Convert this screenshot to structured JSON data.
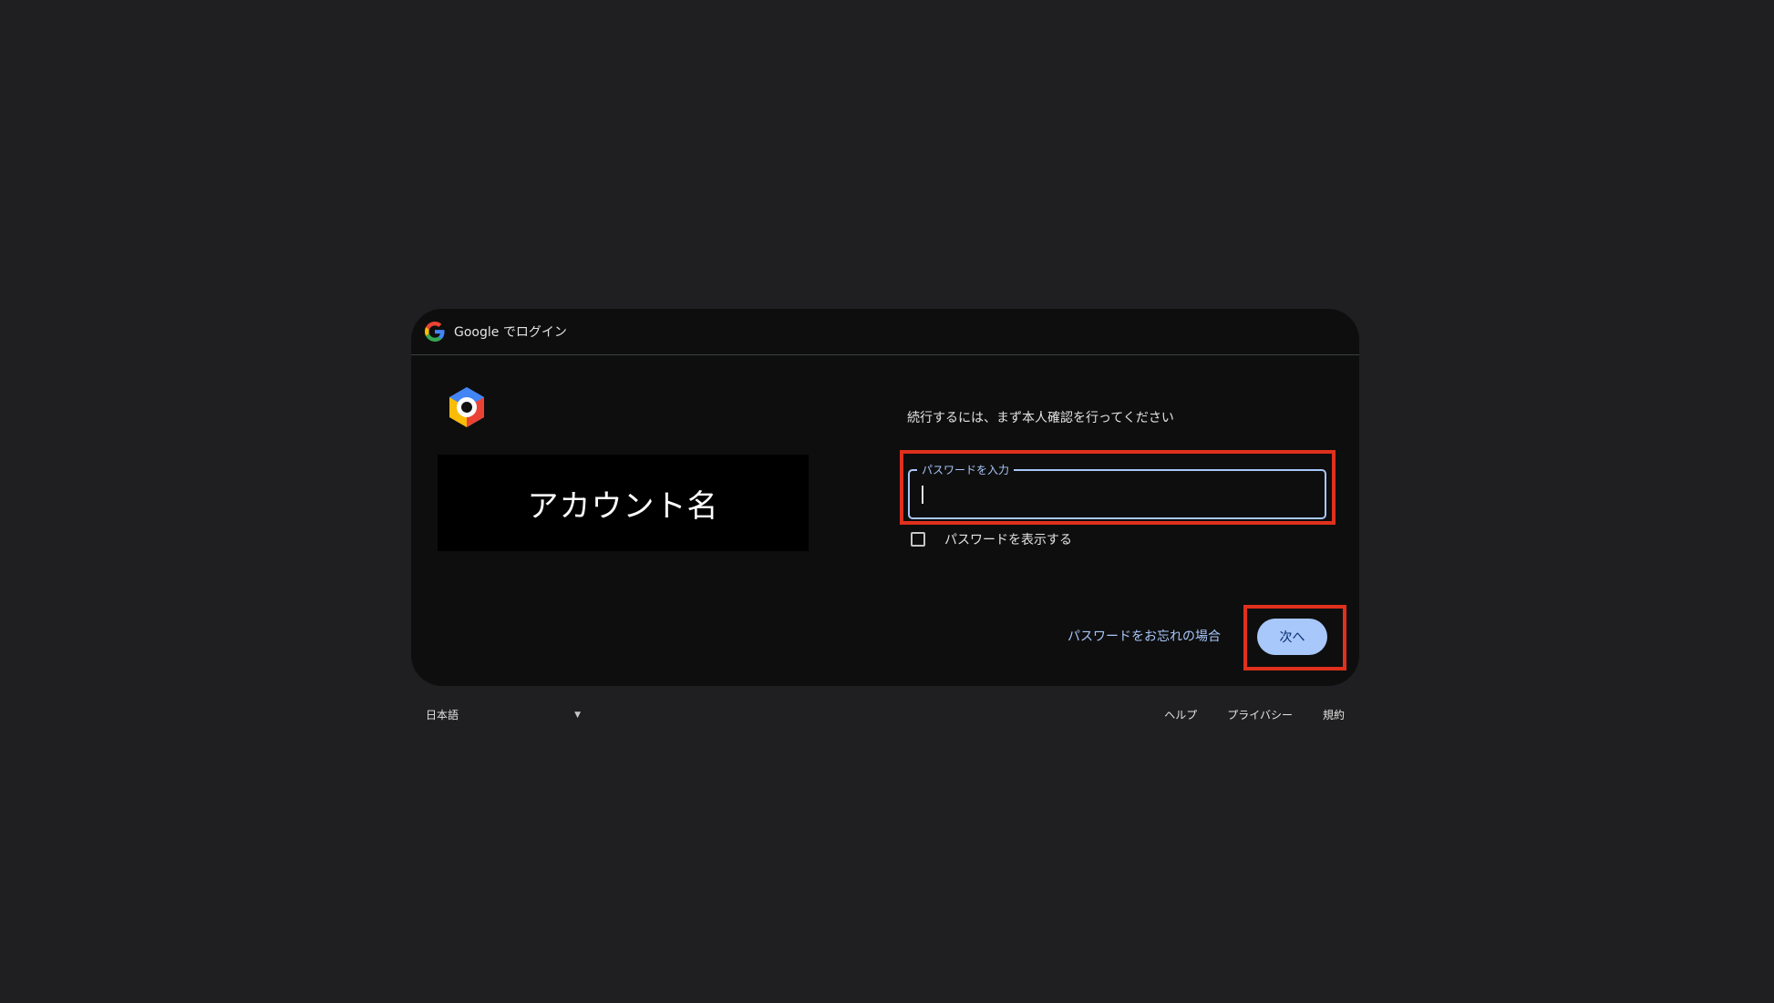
{
  "header": {
    "title": "Google でログイン",
    "logo_icon": "google-g-icon"
  },
  "left": {
    "app_logo_icon": "google-cloud-hexagon-icon",
    "account_name": "アカウント名"
  },
  "right": {
    "instruction": "続行するには、まず本人確認を行ってください",
    "password_field": {
      "label": "パスワードを入力",
      "value": ""
    },
    "show_password_label": "パスワードを表示する",
    "forgot_password_link": "パスワードをお忘れの場合",
    "next_button": "次へ"
  },
  "footer": {
    "language": "日本語",
    "links": [
      "ヘルプ",
      "プライバシー",
      "規約"
    ]
  },
  "colors": {
    "page_bg": "#1f1f21",
    "card_bg": "#0e0e0e",
    "accent": "#a8c7fa",
    "highlight": "#e0301e"
  }
}
